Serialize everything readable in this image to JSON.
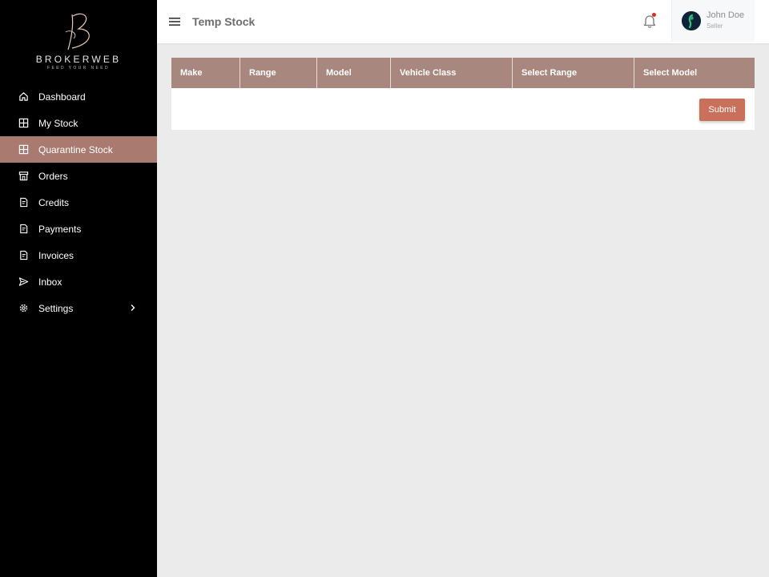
{
  "brand": {
    "name": "BROKERWEB",
    "tagline": "FEED YOUR NEED"
  },
  "sidebar": {
    "items": [
      {
        "label": "Dashboard",
        "icon": "home-icon"
      },
      {
        "label": "My Stock",
        "icon": "stock-icon"
      },
      {
        "label": "Quarantine Stock",
        "icon": "quarantine-icon",
        "active": true
      },
      {
        "label": "Orders",
        "icon": "store-icon"
      },
      {
        "label": "Credits",
        "icon": "document-icon"
      },
      {
        "label": "Payments",
        "icon": "document-icon"
      },
      {
        "label": "Invoices",
        "icon": "document-icon"
      },
      {
        "label": "Inbox",
        "icon": "send-icon"
      },
      {
        "label": "Settings",
        "icon": "gear-icon",
        "has_submenu": true
      }
    ]
  },
  "header": {
    "title": "Temp Stock"
  },
  "user": {
    "name": "John Doe",
    "role": "Seller"
  },
  "table": {
    "columns": [
      "Make",
      "Range",
      "Model",
      "Vehicle Class",
      "Select Range",
      "Select Model"
    ]
  },
  "actions": {
    "submit_label": "Submit"
  },
  "colors": {
    "sidebar_bg": "#000000",
    "active_item": "#a87a70",
    "table_header": "#a8877f",
    "submit_button": "#c9705b",
    "notification_dot": "#d93025"
  }
}
